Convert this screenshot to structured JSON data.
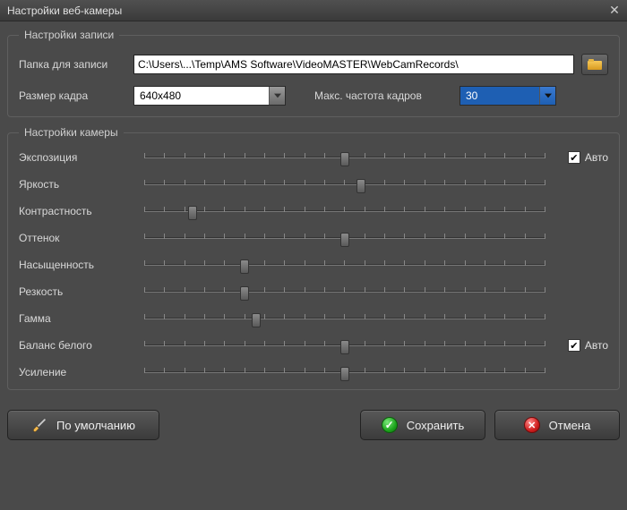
{
  "window": {
    "title": "Настройки веб-камеры"
  },
  "rec": {
    "legend": "Настройки записи",
    "folder_label": "Папка для записи",
    "folder_value": "C:\\Users\\...\\Temp\\AMS Software\\VideoMASTER\\WebCamRecords\\",
    "size_label": "Размер кадра",
    "size_value": "640x480",
    "fps_label": "Макс. частота кадров",
    "fps_value": "30"
  },
  "cam": {
    "legend": "Настройки камеры",
    "auto_label": "Авто",
    "sliders": [
      {
        "label": "Экспозиция",
        "pos": 50,
        "auto": true
      },
      {
        "label": "Яркость",
        "pos": 54,
        "auto": null
      },
      {
        "label": "Контрастность",
        "pos": 12,
        "auto": null
      },
      {
        "label": "Оттенок",
        "pos": 50,
        "auto": null
      },
      {
        "label": "Насыщенность",
        "pos": 25,
        "auto": null
      },
      {
        "label": "Резкость",
        "pos": 25,
        "auto": null
      },
      {
        "label": "Гамма",
        "pos": 28,
        "auto": null
      },
      {
        "label": "Баланс белого",
        "pos": 50,
        "auto": true
      },
      {
        "label": "Усиление",
        "pos": 50,
        "auto": null
      }
    ]
  },
  "buttons": {
    "defaults": "По умолчанию",
    "save": "Сохранить",
    "cancel": "Отмена"
  }
}
